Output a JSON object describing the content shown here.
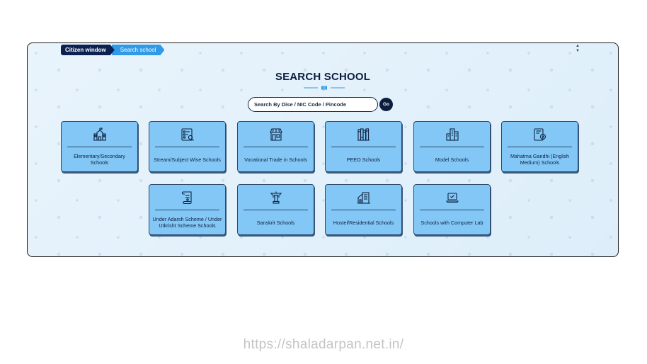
{
  "breadcrumb": {
    "items": [
      "Citizen window",
      "Search school"
    ]
  },
  "scroll": {
    "up": "▲",
    "down": "▼"
  },
  "page": {
    "title": "SEARCH SCHOOL"
  },
  "search": {
    "placeholder": "Search By Dise / NIC Code / Pincode",
    "value": "",
    "go_label": "Go"
  },
  "cards": [
    {
      "label": "Elementary/Secondary Schools",
      "icon": "school-building-icon"
    },
    {
      "label": "Stream/Subject Wise Schools",
      "icon": "list-search-icon"
    },
    {
      "label": "Vocational Trade in Schools",
      "icon": "shop-icon"
    },
    {
      "label": "PEEO Schools",
      "icon": "books-icon"
    },
    {
      "label": "Model Schools",
      "icon": "city-buildings-icon"
    },
    {
      "label": "Mahatma Gandhi (English Medium) Schools",
      "icon": "certificate-badge-icon"
    },
    {
      "label": "Under Adarsh Scheme / Under Utkrisht Scheme Schools",
      "icon": "scroll-document-icon"
    },
    {
      "label": "Sanskrit Schools",
      "icon": "pillar-monument-icon"
    },
    {
      "label": "Hostel/Residential Schools",
      "icon": "hostel-building-icon"
    },
    {
      "label": "Schools with Computer Lab",
      "icon": "laptop-icon"
    }
  ],
  "footer": {
    "url": "https://shaladarpan.net.in/"
  },
  "colors": {
    "card_bg": "#82c7f6",
    "dark_navy": "#0d1d3f",
    "accent_blue": "#2f9ae8",
    "panel_bg": "#ddeefa"
  }
}
